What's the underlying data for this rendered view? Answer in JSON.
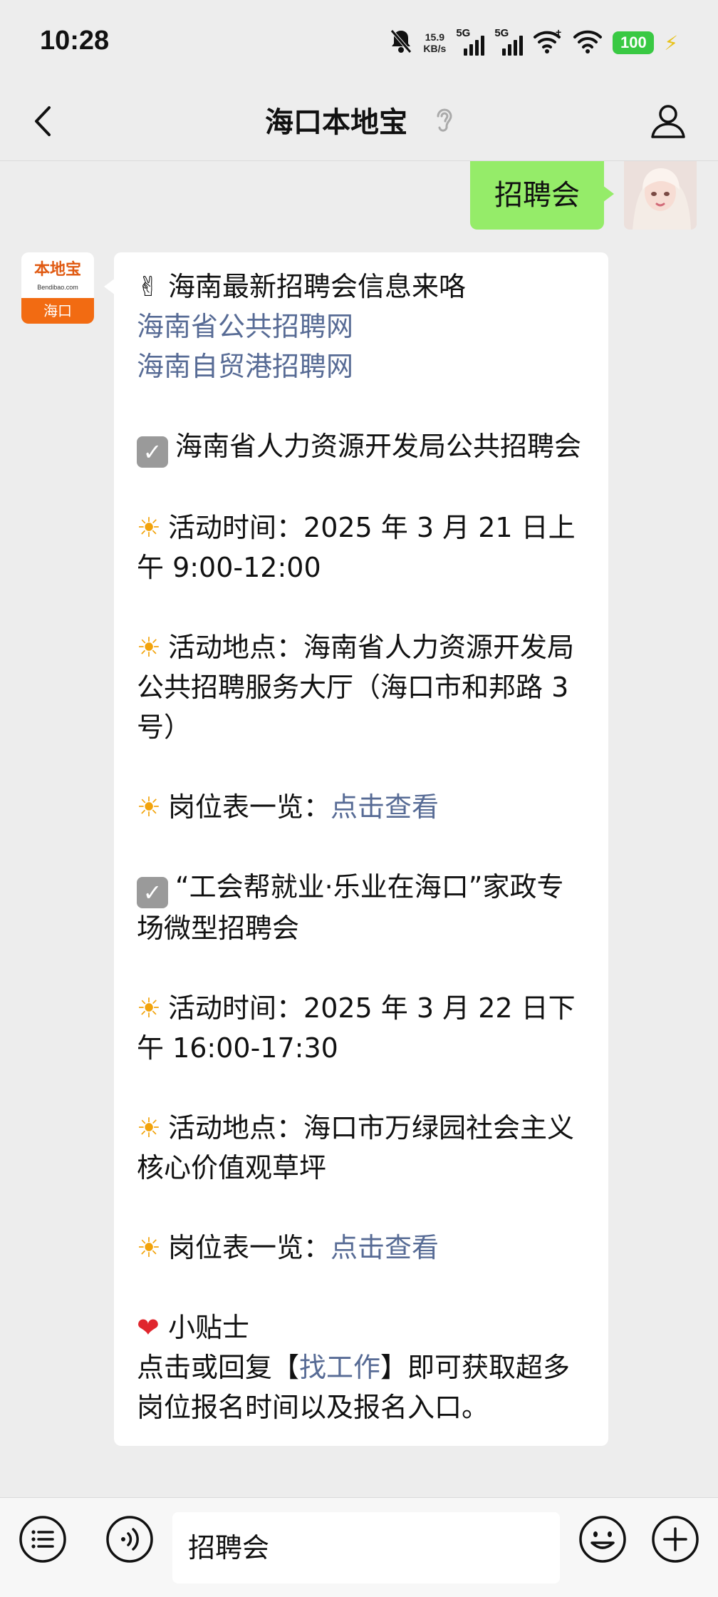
{
  "status_bar": {
    "time": "10:28",
    "speed_value": "15.9",
    "speed_unit": "KB/s",
    "sim1_label": "5G",
    "sim2_label": "5G",
    "battery": "100",
    "icons": [
      "mute-bell-icon",
      "wifi-plus-icon",
      "wifi-icon",
      "charging-bolt-icon"
    ]
  },
  "nav": {
    "title": "海口本地宝",
    "icons": [
      "back-chevron-icon",
      "ear-icon",
      "profile-icon"
    ]
  },
  "chat": {
    "sent_message": "招聘会",
    "bot_avatar": {
      "brand": "本地宝",
      "domain": "Bendibao.com",
      "city": "海口"
    },
    "reply": {
      "intro_emoji": "✌",
      "intro": "海南最新招聘会信息来咯",
      "link1": "海南省公共招聘网",
      "link2": "海南自贸港招聘网",
      "event1": {
        "title": "海南省人力资源开发局公共招聘会",
        "time_label": "活动时间：",
        "time": "2025 年 3 月 21 日上午 9:00-12:00",
        "place_label": "活动地点：",
        "place": "海南省人力资源开发局公共招聘服务大厅（海口市和邦路 3 号）",
        "jobs_label": "岗位表一览：",
        "jobs_link": "点击查看"
      },
      "event2": {
        "title": "“工会帮就业·乐业在海口”家政专场微型招聘会",
        "time_label": "活动时间：",
        "time": "2025 年 3 月 22 日下午 16:00-17:30",
        "place_label": "活动地点：",
        "place": "海口市万绿园社会主义核心价值观草坪",
        "jobs_label": "岗位表一览：",
        "jobs_link": "点击查看"
      },
      "tip_title": "小贴士",
      "tip_before": "点击或回复【",
      "tip_link": "找工作",
      "tip_after": "】即可获取超多岗位报名时间以及报名入口。"
    }
  },
  "input_bar": {
    "value": "招聘会",
    "icons": [
      "menu-list-icon",
      "voice-icon",
      "emoji-icon",
      "plus-icon"
    ]
  },
  "colors": {
    "sent_bubble": "#95ec69",
    "link": "#576b95",
    "background": "#ededed",
    "brand_orange": "#f26b12"
  }
}
